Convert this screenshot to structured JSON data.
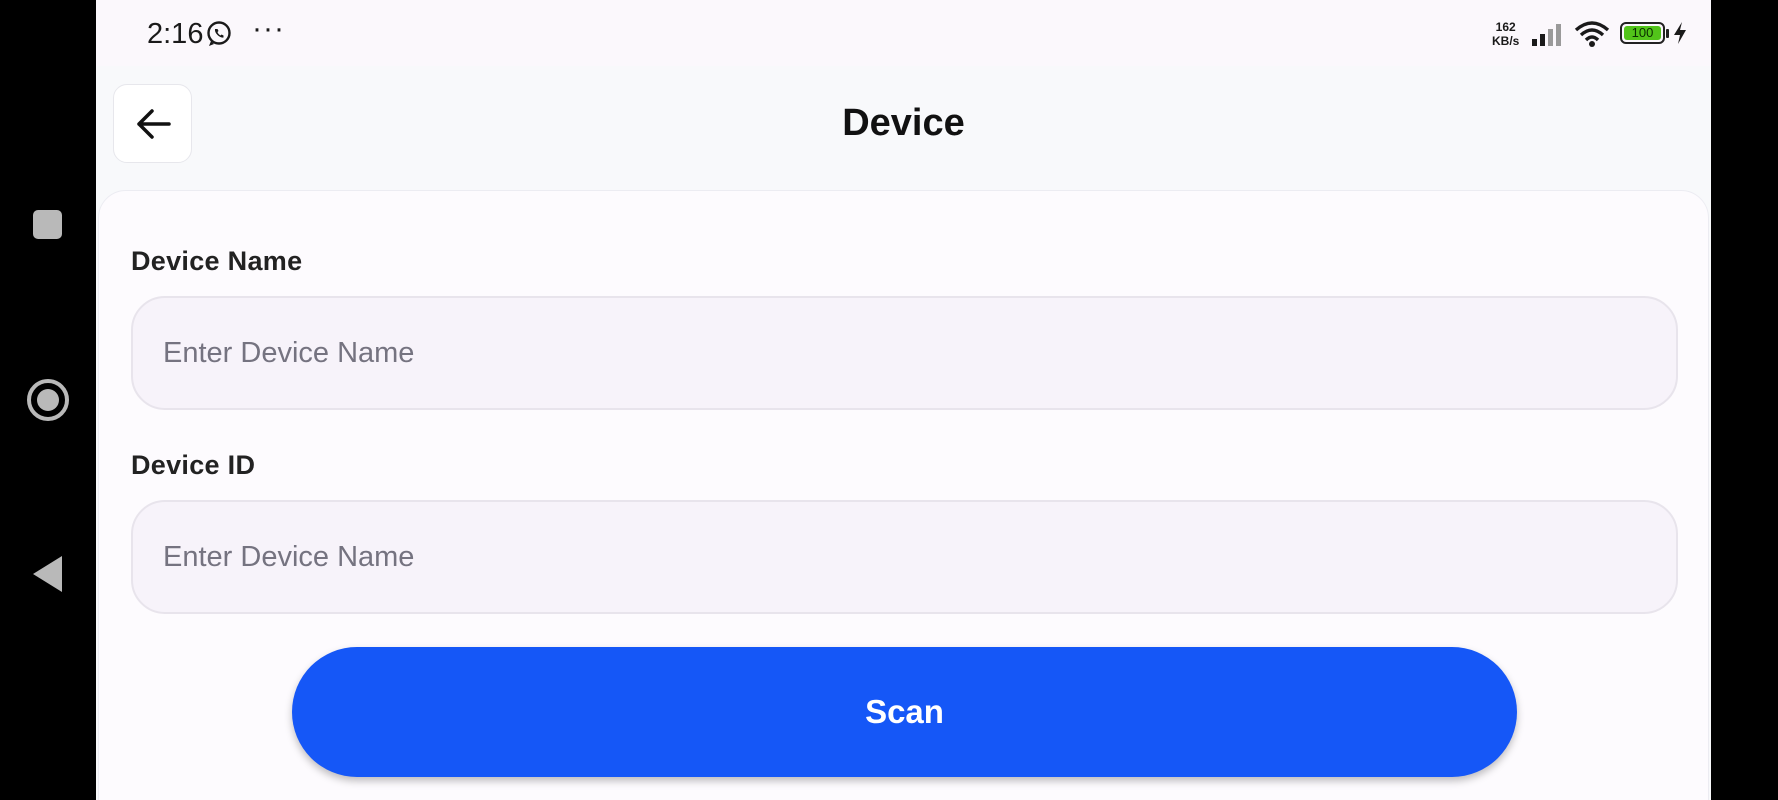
{
  "status_bar": {
    "time": "2:16",
    "more_dots": "···",
    "net_speed_value": "162",
    "net_speed_unit": "KB/s",
    "battery": "100",
    "battery_color": "#52c41a"
  },
  "app_bar": {
    "title": "Device",
    "back_icon": "arrow-left-icon"
  },
  "form": {
    "device_name": {
      "label": "Device Name",
      "value": "",
      "placeholder": "Enter Device Name"
    },
    "device_id": {
      "label": "Device ID",
      "value": "",
      "placeholder": "Enter Device Name"
    },
    "scan_button": {
      "label": "Scan",
      "color": "#1557f7"
    }
  },
  "system_nav": {
    "items": [
      "recents-icon",
      "home-icon",
      "back-icon"
    ]
  }
}
